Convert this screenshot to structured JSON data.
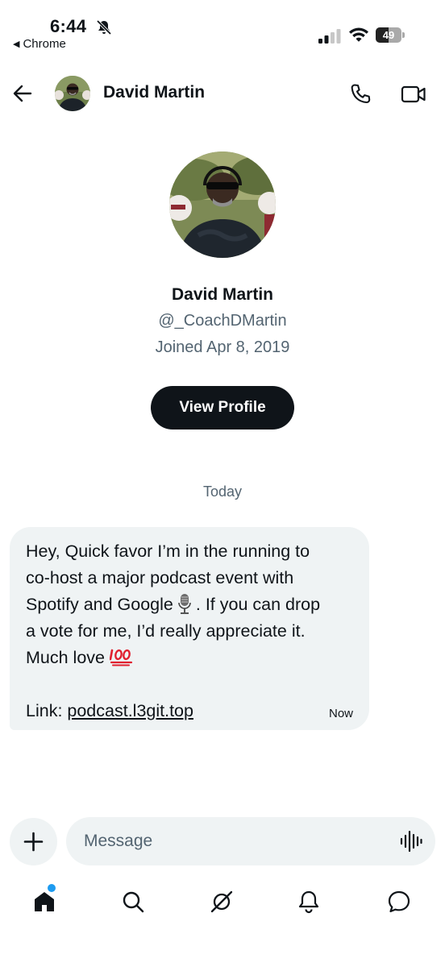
{
  "status_bar": {
    "time": "6:44",
    "back_app": "Chrome",
    "battery_percent": "49",
    "battery_level": 0.49,
    "icons": [
      "bell-slash-icon",
      "signal-icon",
      "wifi-icon",
      "battery-icon"
    ]
  },
  "header": {
    "name": "David Martin",
    "icons": [
      "back-arrow-icon",
      "phone-icon",
      "video-icon"
    ]
  },
  "profile": {
    "name": "David Martin",
    "handle": "@_CoachDMartin",
    "joined": "Joined Apr 8, 2019",
    "button_label": "View Profile"
  },
  "conversation": {
    "date_label": "Today",
    "message": {
      "line1": "Hey, Quick favor I’m in the running to",
      "line2": "co-host a major podcast event with",
      "line3_a": "Spotify and Google",
      "line3_b": ". If you can drop",
      "line4": "a vote for me, I’d really appreciate it.",
      "line5": "Much love",
      "link_prefix": "Link: ",
      "link_text": "podcast.l3git.top",
      "timestamp": "Now",
      "emoji_icons": [
        "microphone-icon",
        "hundred-points-icon"
      ]
    }
  },
  "composer": {
    "placeholder": "Message",
    "value": "",
    "icons": [
      "plus-icon",
      "voice-waveform-icon"
    ]
  },
  "tab_bar": {
    "tabs": [
      "home-icon",
      "search-icon",
      "grok-icon",
      "notifications-bell-icon",
      "messages-icon"
    ],
    "home_badge_color": "#1d9bf0"
  },
  "colors": {
    "text": "#0f1419",
    "secondary_text": "#536471",
    "bubble": "#eff3f4",
    "button": "#0f1419",
    "accent": "#1d9bf0"
  }
}
